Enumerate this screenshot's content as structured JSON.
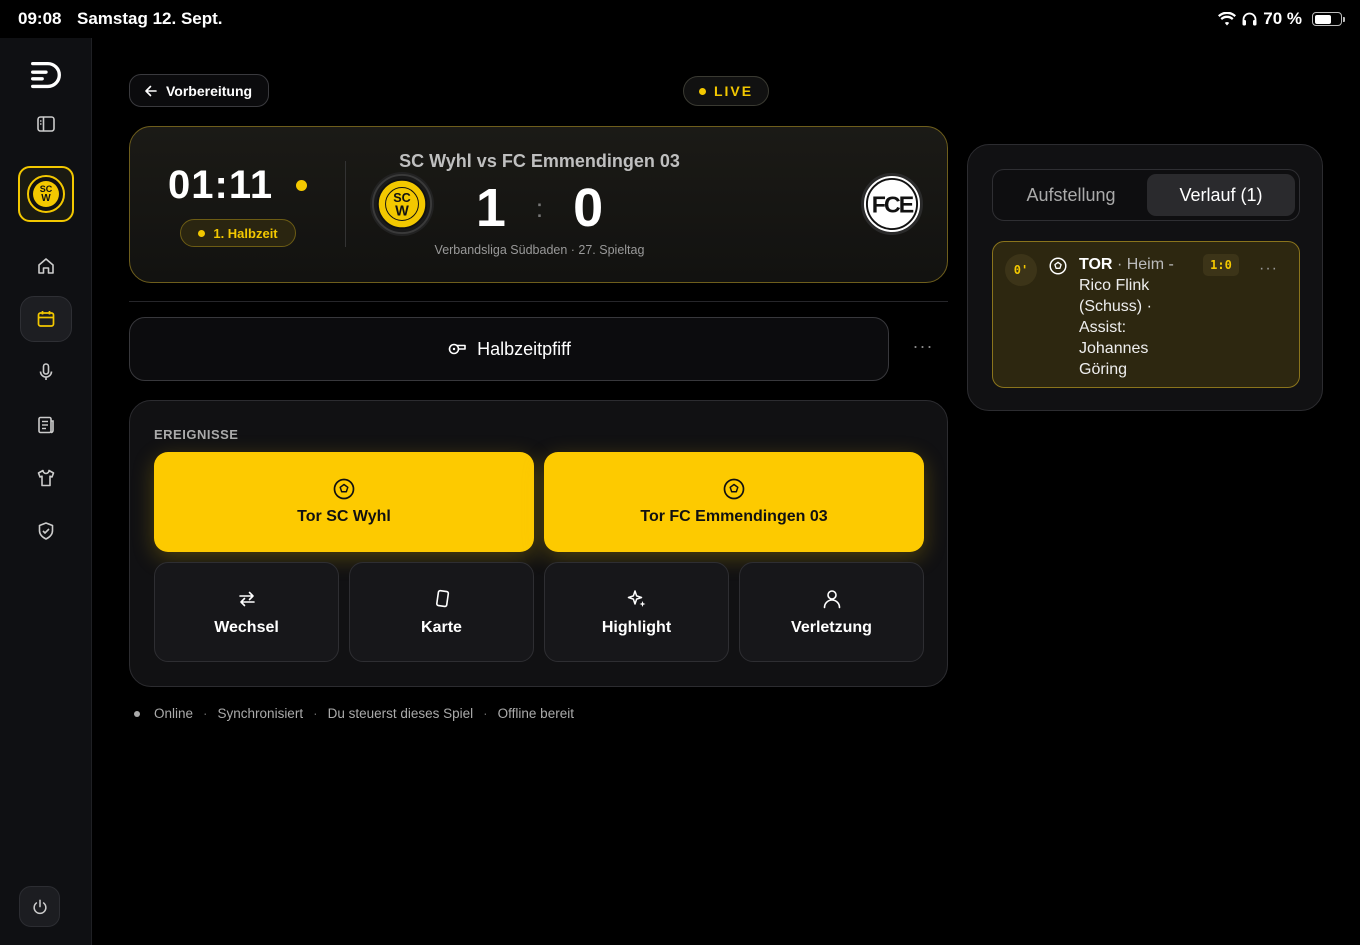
{
  "status_bar": {
    "time": "09:08",
    "date": "Samstag 12. Sept.",
    "battery": "70 %",
    "battery_level": 0.7
  },
  "sidebar": {
    "icons": [
      "app-logo-icon",
      "sidebar-toggle-icon",
      "home-icon",
      "calendar-icon",
      "microphone-icon",
      "document-icon",
      "jersey-icon",
      "shield-icon",
      "power-icon"
    ],
    "active": "calendar-icon"
  },
  "header": {
    "back_label": "Vorbereitung",
    "live_label": "LIVE"
  },
  "scoreboard": {
    "clock": "01:11",
    "period": "1. Halbzeit",
    "title": "SC Wyhl vs FC Emmendingen 03",
    "home_score": "1",
    "away_score": "0",
    "league": "Verbandsliga Südbaden · 27. Spieltag",
    "home_logo_text": "SCW",
    "away_logo_text": "FCE"
  },
  "halftime": {
    "label": "Halbzeitpfiff",
    "more": "···"
  },
  "events": {
    "title": "EREIGNISSE",
    "goal_home": "Tor SC Wyhl",
    "goal_away": "Tor FC Emmendingen 03",
    "sub": "Wechsel",
    "card": "Karte",
    "highlight": "Highlight",
    "injury": "Verletzung"
  },
  "footer": {
    "online": "Online",
    "synced": "Synchronisiert",
    "control": "Du steuerst dieses Spiel",
    "offline": "Offline bereit"
  },
  "right_panel": {
    "tab_lineup": "Aufstellung",
    "tab_history": "Verlauf (1)",
    "event": {
      "minute": "0'",
      "type": "TOR",
      "side": "· Heim -",
      "description": "Rico Flink (Schuss) · Assist: Johannes Göring",
      "score": "1:0",
      "more": "···"
    }
  },
  "colors": {
    "accent": "#fdca00",
    "background": "#000000",
    "panel": "#111113"
  }
}
